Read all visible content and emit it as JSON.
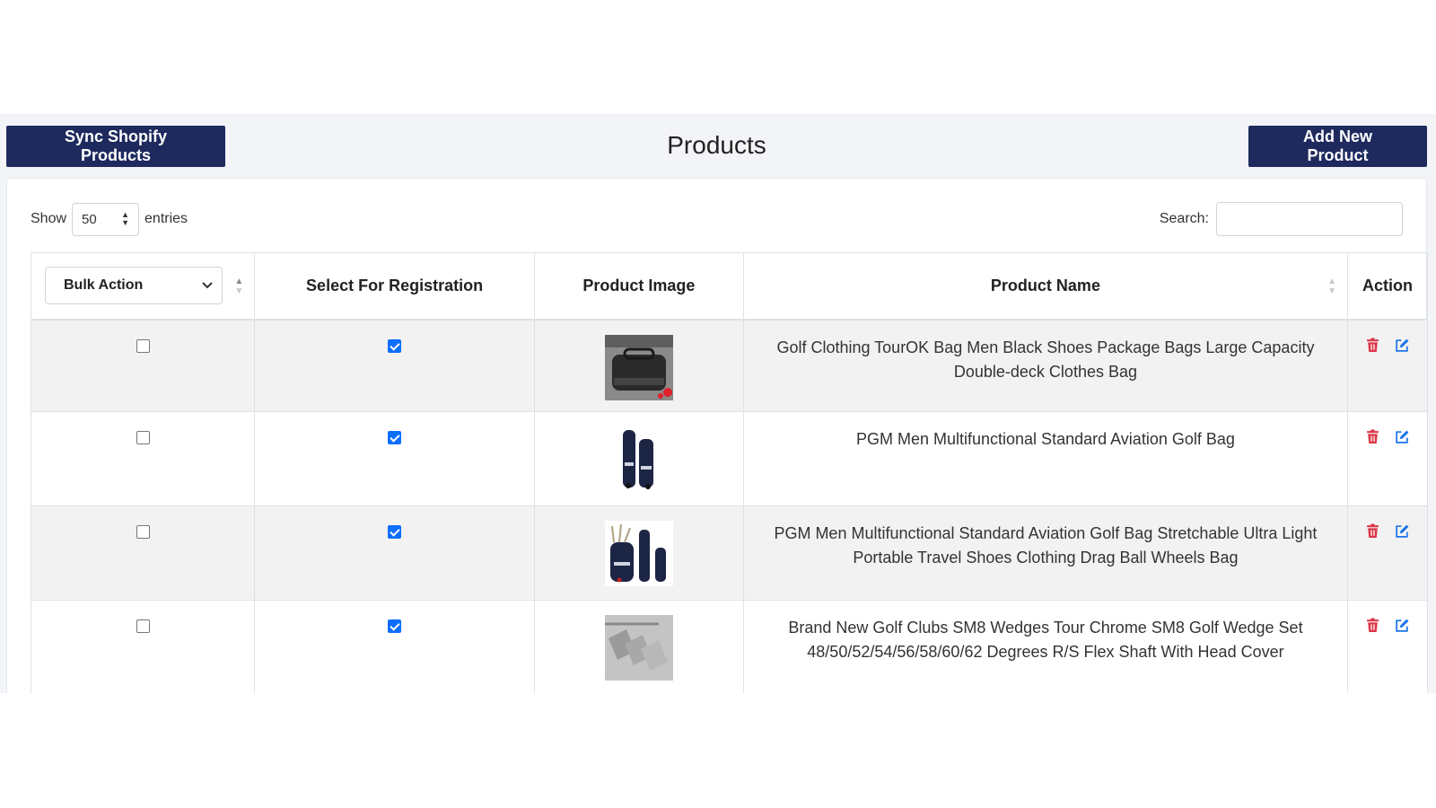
{
  "toolbar": {
    "sync_label": "Sync Shopify Products",
    "title": "Products",
    "add_label": "Add New Product"
  },
  "table_controls": {
    "show_label": "Show",
    "entries_value": "50",
    "entries_label": "entries",
    "search_label": "Search:",
    "search_value": ""
  },
  "columns": {
    "bulk_action": "Bulk Action",
    "select_for_registration": "Select For Registration",
    "product_image": "Product Image",
    "product_name": "Product Name",
    "action": "Action"
  },
  "rows": [
    {
      "selected": false,
      "registered": true,
      "image": "golf-bag-image",
      "name": "Golf Clothing TourOK Bag Men Black Shoes Package Bags Large Capacity Double-deck Clothes Bag"
    },
    {
      "selected": false,
      "registered": true,
      "image": "golf-bag-image",
      "name": "PGM Men Multifunctional Standard Aviation Golf Bag"
    },
    {
      "selected": false,
      "registered": true,
      "image": "golf-bag-image",
      "name": "PGM Men Multifunctional Standard Aviation Golf Bag Stretchable Ultra Light Portable Travel Shoes Clothing Drag Ball Wheels Bag"
    },
    {
      "selected": false,
      "registered": true,
      "image": "golf-wedge-image",
      "name": "Brand New Golf Clubs SM8 Wedges Tour Chrome SM8 Golf Wedge Set 48/50/52/54/56/58/60/62 Degrees R/S Flex Shaft With Head Cover"
    }
  ],
  "colors": {
    "primary_dark": "#1e2a5e",
    "checkbox": "#0d6efd",
    "delete": "#dc3545",
    "edit": "#1a73e8"
  },
  "icons": {
    "delete": "trash-icon",
    "edit": "edit-icon"
  }
}
